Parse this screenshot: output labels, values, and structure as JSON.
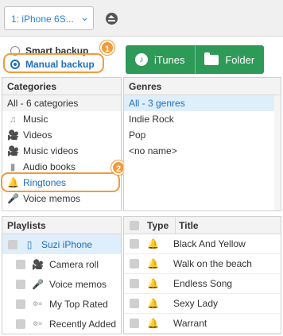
{
  "device": {
    "name": "1: iPhone 6S...",
    "chevron": "⌄"
  },
  "backup": {
    "smart_label": "Smart backup",
    "manual_label": "Manual backup",
    "badge1": "1",
    "badge2": "2"
  },
  "buttons": {
    "itunes": "iTunes",
    "folder": "Folder"
  },
  "categories": {
    "header": "Categories",
    "items": [
      {
        "label": "All - 6 categories",
        "icon": ""
      },
      {
        "label": "Music",
        "icon": "♫"
      },
      {
        "label": "Videos",
        "icon": "🎥"
      },
      {
        "label": "Music videos",
        "icon": "🎥"
      },
      {
        "label": "Audio books",
        "icon": "▮"
      },
      {
        "label": "Ringtones",
        "icon": "🔔"
      },
      {
        "label": "Voice memos",
        "icon": "🎤"
      }
    ]
  },
  "genres": {
    "header": "Genres",
    "items": [
      "All - 3 genres",
      "Indie Rock",
      "Pop",
      "<no name>"
    ]
  },
  "playlists": {
    "header": "Playlists",
    "items": [
      {
        "label": "Suzi iPhone",
        "icon": "▯"
      },
      {
        "label": "Camera roll",
        "icon": "🎥"
      },
      {
        "label": "Voice memos",
        "icon": "🎤"
      },
      {
        "label": "My Top Rated",
        "icon": "⚙≡"
      },
      {
        "label": "Recently Added",
        "icon": "⚙≡"
      }
    ]
  },
  "tracks": {
    "col_type": "Type",
    "col_title": "Title",
    "items": [
      "Black And Yellow",
      "Walk on the beach",
      "Endless Song",
      "Sexy Lady",
      "Warrant"
    ]
  },
  "colors": {
    "accent": "#1d6fc0",
    "highlight": "#f39a3b",
    "green": "#2e9a58"
  }
}
